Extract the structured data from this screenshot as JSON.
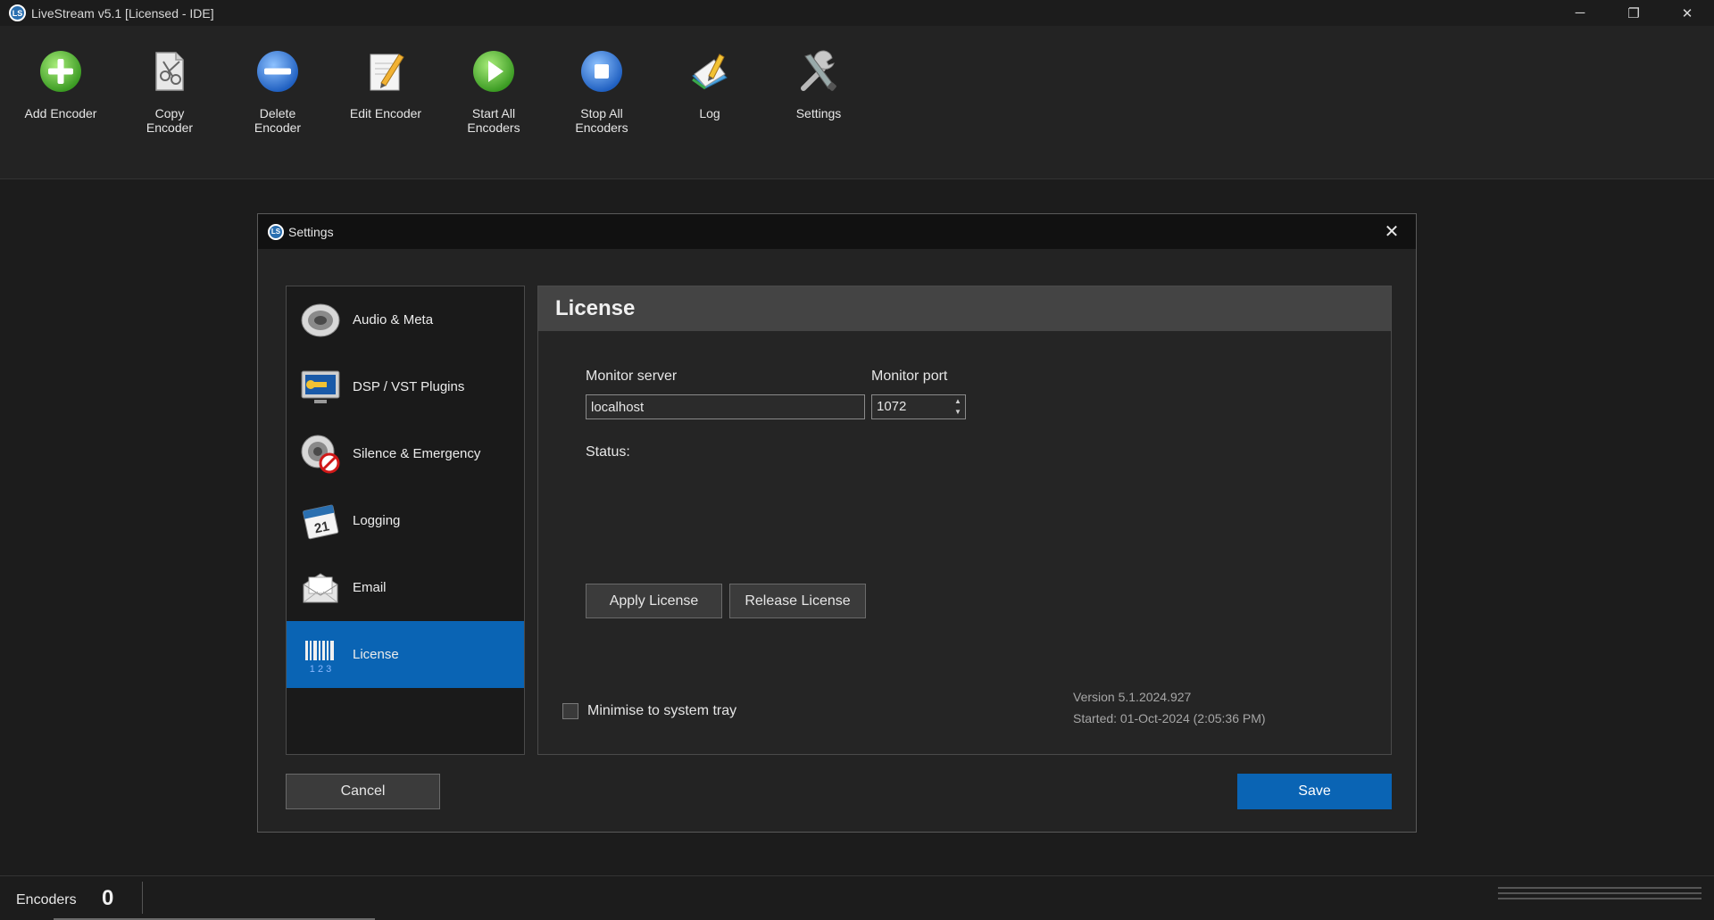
{
  "window": {
    "logo_text": "LS",
    "title": "LiveStream v5.1 [Licensed - IDE]",
    "minimize": "─",
    "restore": "❐",
    "close": "✕"
  },
  "toolbar": {
    "items": [
      {
        "label": "Add Encoder",
        "icon": "add-icon"
      },
      {
        "label": "Copy\nEncoder",
        "icon": "copy-icon"
      },
      {
        "label": "Delete\nEncoder",
        "icon": "delete-icon"
      },
      {
        "label": "Edit Encoder",
        "icon": "edit-icon"
      },
      {
        "label": "Start All\nEncoders",
        "icon": "play-icon"
      },
      {
        "label": "Stop All\nEncoders",
        "icon": "stop-icon"
      },
      {
        "label": "Log",
        "icon": "log-icon"
      },
      {
        "label": "Settings",
        "icon": "settings-icon"
      }
    ]
  },
  "dialog": {
    "logo_text": "LS",
    "title": "Settings",
    "close": "✕",
    "nav": [
      {
        "label": "Audio & Meta",
        "icon": "speaker-icon",
        "active": false
      },
      {
        "label": "DSP / VST Plugins",
        "icon": "plugin-icon",
        "active": false
      },
      {
        "label": "Silence & Emergency",
        "icon": "silence-icon",
        "active": false
      },
      {
        "label": "Logging",
        "icon": "calendar-icon",
        "active": false
      },
      {
        "label": "Email",
        "icon": "email-icon",
        "active": false
      },
      {
        "label": "License",
        "icon": "barcode-icon",
        "active": true
      }
    ],
    "license": {
      "header": "License",
      "monitor_server_label": "Monitor server",
      "monitor_server_value": "localhost",
      "monitor_port_label": "Monitor port",
      "monitor_port_value": "1072",
      "status_label": "Status:",
      "apply_button": "Apply License",
      "release_button": "Release License",
      "minimise_label": "Minimise to system tray",
      "minimise_checked": false,
      "version": "Version 5.1.2024.927",
      "started": "Started: 01-Oct-2024 (2:05:36 PM)"
    },
    "cancel_button": "Cancel",
    "save_button": "Save"
  },
  "statusbar": {
    "encoders_label": "Encoders",
    "encoders_count": "0"
  },
  "colors": {
    "accent": "#0a64b4",
    "background": "#1c1c1c",
    "panel": "#252525"
  }
}
